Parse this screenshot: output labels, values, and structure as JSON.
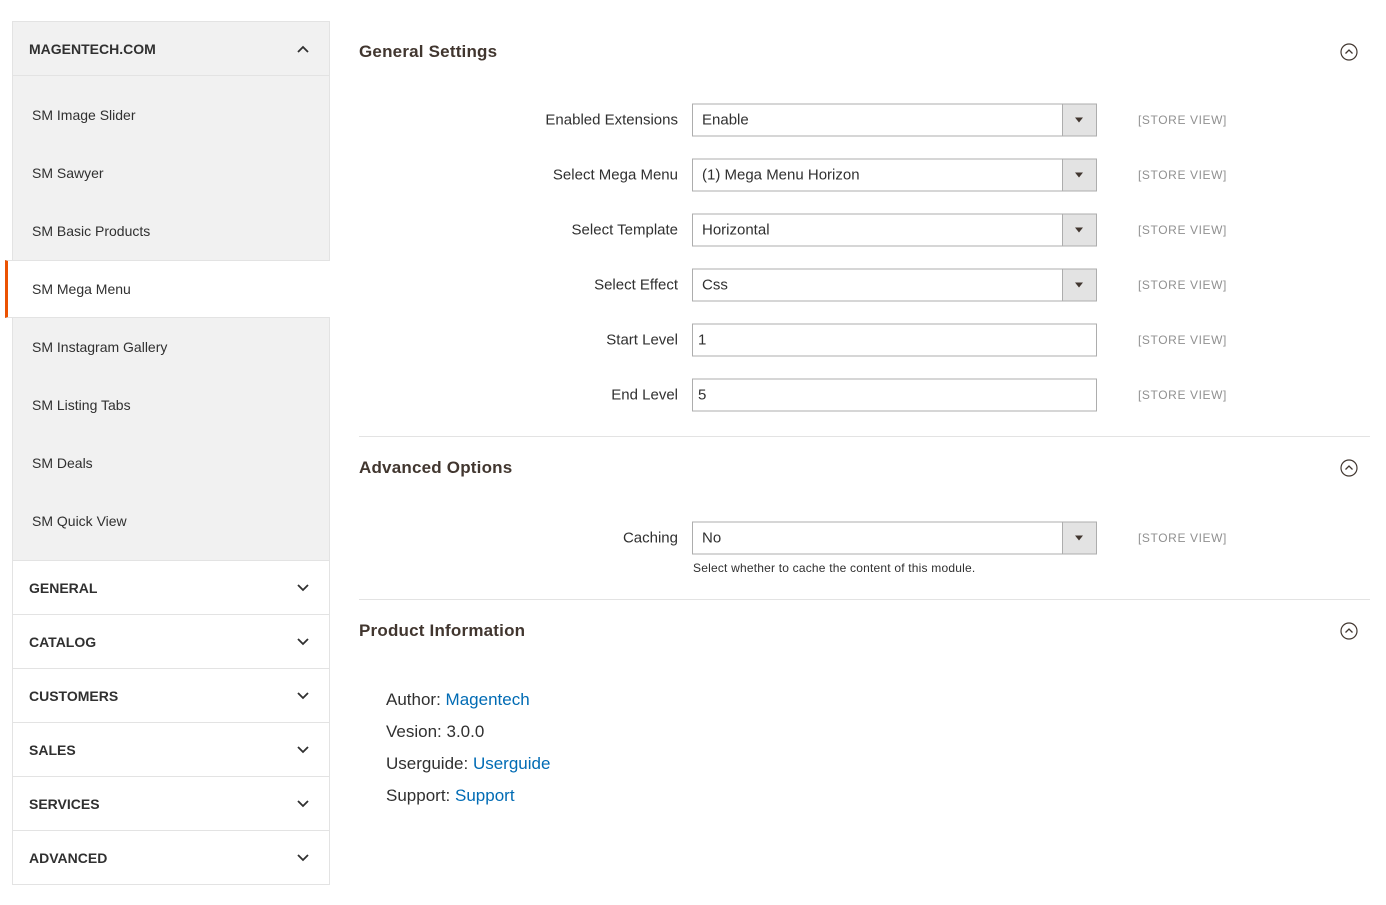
{
  "sidebar": {
    "open_group": {
      "title": "MAGENTECH.COM",
      "items": [
        {
          "label": "SM Image Slider",
          "active": false
        },
        {
          "label": "SM Sawyer",
          "active": false
        },
        {
          "label": "SM Basic Products",
          "active": false
        },
        {
          "label": "SM Mega Menu",
          "active": true
        },
        {
          "label": "SM Instagram Gallery",
          "active": false
        },
        {
          "label": "SM Listing Tabs",
          "active": false
        },
        {
          "label": "SM Deals",
          "active": false
        },
        {
          "label": "SM Quick View",
          "active": false
        }
      ]
    },
    "groups": [
      "GENERAL",
      "CATALOG",
      "CUSTOMERS",
      "SALES",
      "SERVICES",
      "ADVANCED"
    ]
  },
  "general_settings": {
    "title": "General Settings",
    "fields": [
      {
        "label": "Enabled Extensions",
        "value": "Enable",
        "type": "select",
        "scope": "[STORE VIEW]"
      },
      {
        "label": "Select Mega Menu",
        "value": "(1) Mega Menu Horizon",
        "type": "select",
        "scope": "[STORE VIEW]"
      },
      {
        "label": "Select Template",
        "value": "Horizontal",
        "type": "select",
        "scope": "[STORE VIEW]"
      },
      {
        "label": "Select Effect",
        "value": "Css",
        "type": "select",
        "scope": "[STORE VIEW]"
      },
      {
        "label": "Start Level",
        "value": "1",
        "type": "input",
        "scope": "[STORE VIEW]"
      },
      {
        "label": "End Level",
        "value": "5",
        "type": "input",
        "scope": "[STORE VIEW]"
      }
    ]
  },
  "advanced_options": {
    "title": "Advanced Options",
    "caching": {
      "label": "Caching",
      "value": "No",
      "scope": "[STORE VIEW]",
      "note": "Select whether to cache the content of this module."
    }
  },
  "product_information": {
    "title": "Product Information",
    "author_label": "Author:",
    "author_link": "Magentech",
    "version_label": "Vesion: 3.0.0",
    "userguide_label": "Userguide:",
    "userguide_link": "Userguide",
    "support_label": "Support:",
    "support_link": "Support"
  },
  "colors": {
    "active_accent": "#eb5202",
    "link": "#006bb4",
    "sidebar_bg": "#f1f1f1"
  },
  "icons": {
    "open_group": "chevron-up-icon",
    "closed_group": "chevron-down-icon",
    "panel_toggle": "circle-chevron-up-icon",
    "select_arrow": "caret-down-icon"
  }
}
